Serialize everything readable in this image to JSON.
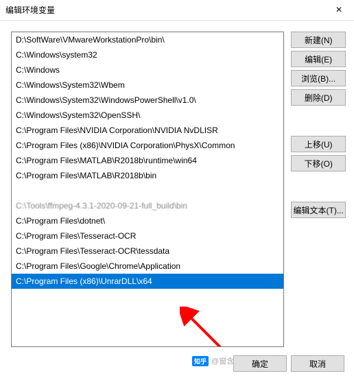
{
  "title": "编辑环境变量",
  "close_label": "×",
  "paths": [
    "D:\\SoftWare\\VMwareWorkstationPro\\bin\\",
    "C:\\Windows\\system32",
    "C:\\Windows",
    "C:\\Windows\\System32\\Wbem",
    "C:\\Windows\\System32\\WindowsPowerShell\\v1.0\\",
    "C:\\Windows\\System32\\OpenSSH\\",
    "C:\\Program Files\\NVIDIA Corporation\\NVIDIA NvDLISR",
    "C:\\Program Files (x86)\\NVIDIA Corporation\\PhysX\\Common",
    "C:\\Program Files\\MATLAB\\R2018b\\runtime\\win64",
    "C:\\Program Files\\MATLAB\\R2018b\\bin",
    "",
    "C:\\Tools\\ffmpeg-4.3.1-2020-09-21-full_build\\bin",
    "C:\\Program Files\\dotnet\\",
    "C:\\Program Files\\Tesseract-OCR",
    "C:\\Program Files\\Tesseract-OCR\\tessdata",
    "C:\\Program Files\\Google\\Chrome\\Application",
    "C:\\Program Files (x86)\\UnrarDLL\\x64"
  ],
  "selected_index": 16,
  "faded_index": 11,
  "buttons": {
    "new": "新建(N)",
    "edit": "编辑(E)",
    "browse": "浏览(B)...",
    "delete": "删除(D)",
    "move_up": "上移(U)",
    "move_down": "下移(O)",
    "edit_text": "编辑文本(T)..."
  },
  "footer": {
    "ok": "确定",
    "cancel": "取消"
  },
  "watermark": "窗含西岭千秋雪",
  "zhihu": "知乎"
}
